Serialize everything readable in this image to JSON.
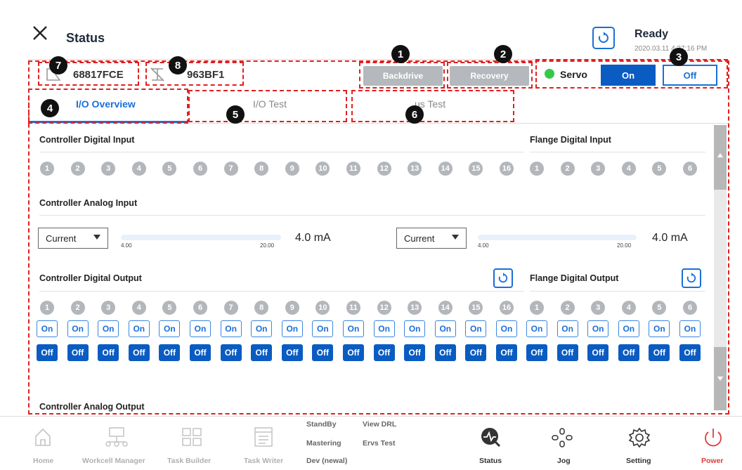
{
  "header": {
    "title": "Status",
    "state": "Ready",
    "timestamp": "2020.03.11 4:37:16 PM"
  },
  "devices": [
    {
      "id": "68817FCE"
    },
    {
      "id": "963BF1"
    }
  ],
  "toolbar": {
    "backdrive_label": "Backdrive",
    "recovery_label": "Recovery",
    "servo_label": "Servo",
    "servo_on": "On",
    "servo_off": "Off",
    "servo_color": "#37c74a"
  },
  "tabs": [
    {
      "label": "I/O Overview",
      "active": true
    },
    {
      "label": "I/O Test"
    },
    {
      "label": "us Test"
    }
  ],
  "io": {
    "controller_digital_input": "Controller Digital Input",
    "flange_digital_input": "Flange Digital Input",
    "controller_analog_input": "Controller Analog Input",
    "controller_digital_output": "Controller Digital Output",
    "flange_digital_output": "Flange Digital Output",
    "controller_analog_output": "Controller Analog Output",
    "controller_numbers": [
      "1",
      "2",
      "3",
      "4",
      "5",
      "6",
      "7",
      "8",
      "9",
      "10",
      "11",
      "12",
      "13",
      "14",
      "15",
      "16"
    ],
    "flange_numbers": [
      "1",
      "2",
      "3",
      "4",
      "5",
      "6"
    ],
    "analog": [
      {
        "mode": "Current",
        "min": "4.00",
        "max": "20.00",
        "value": "4.0 mA"
      },
      {
        "mode": "Current",
        "min": "4.00",
        "max": "20.00",
        "value": "4.0 mA"
      }
    ],
    "on_label": "On",
    "off_label": "Off"
  },
  "annotations": [
    "1",
    "2",
    "3",
    "4",
    "5",
    "6",
    "7",
    "8"
  ],
  "nav": {
    "home": "Home",
    "workcell": "Workcell Manager",
    "task_builder": "Task Builder",
    "task_writer": "Task Writer",
    "menu": [
      "StandBy",
      "View DRL",
      "Mastering",
      "Ervs Test",
      "Dev (newal)"
    ],
    "status": "Status",
    "jog": "Jog",
    "setting": "Setting",
    "power": "Power"
  },
  "colors": {
    "accent": "#1a6fd8",
    "primary_dark": "#0a5cc2",
    "annotation": "#e02020",
    "power": "#e03a3a"
  }
}
